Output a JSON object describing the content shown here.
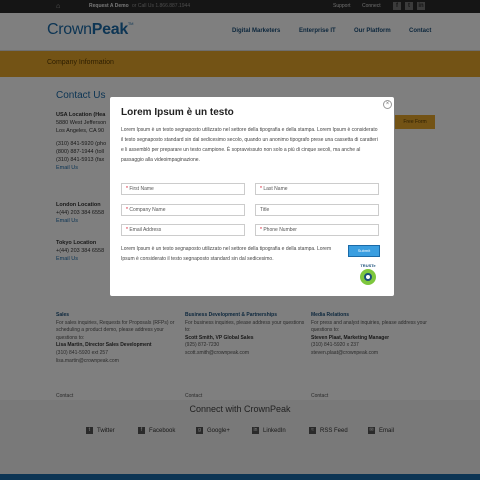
{
  "topbar": {
    "request_demo": "Request A Demo",
    "call_text": "or Call Us 1.866.887.1944",
    "support": "Support",
    "connect": "Connect"
  },
  "header": {
    "logo_main": "Crown",
    "logo_bold": "Peak",
    "logo_tm": "TM",
    "nav": [
      "Digital Marketers",
      "Enterprise IT",
      "Our Platform",
      "Contact"
    ]
  },
  "banner": {
    "title": "Company Information"
  },
  "contact": {
    "title": "Contact Us",
    "free_form_button": "Free Form",
    "usa": {
      "title": "USA Location (Hea",
      "line1": "5880 West Jefferson",
      "line2": "Los Angeles, CA 90",
      "phone1": "(310) 841-5920 (pho",
      "phone2": "(800) 887-1944 (toll",
      "phone3": "(310) 841-5913 (fax",
      "email": "Email Us"
    },
    "london": {
      "title": "London Location",
      "phone": "+(44) 203 384 6558",
      "email": "Email Us"
    },
    "tokyo": {
      "title": "Tokyo Location",
      "phone": "+(44) 203 384 6558",
      "email": "Email Us"
    }
  },
  "lower": {
    "sales": {
      "heading": "Sales",
      "desc": "For sales inquiries, Requests for Proposals (RFPs) or scheduling a product demo, please address your questions to:",
      "name": "Lisa Martin, Director Sales Development",
      "phone": "(310) 841-5920 ext 257",
      "email": "lisa.martin@crownpeak.com",
      "button": "Contact"
    },
    "bizdev": {
      "heading": "Business Development & Partnerships",
      "desc": "For business inquiries, please address your questions to:",
      "name": "Scott Smith, VP Global Sales",
      "phone": "(925) 872-7230",
      "email": "scott.smith@crownpeak.com",
      "button": "Contact"
    },
    "media": {
      "heading": "Media Relations",
      "desc": "For press and analyst inquiries, please address your questions to:",
      "name": "Steven Plaat, Marketing Manager",
      "phone": "(310) 841-5920 x 237",
      "email": "steven.plaat@crownpeak.com",
      "button": "Contact"
    }
  },
  "footer": {
    "title": "Connect with CrownPeak",
    "social": [
      "Twitter",
      "Facebook",
      "Google+",
      "LinkedIn",
      "RSS Feed",
      "Email"
    ]
  },
  "modal": {
    "title": "Lorem Ipsum è un testo",
    "desc": "Lorem Ipsum è un testo segnaposto utilizzato nel settore della tipografia e della stampa. Lorem Ipsum è considerato il testo segnaposto standard sin dal sedicesimo secolo, quando un anonimo tipografo prese una cassetta di caratteri e li assemblò per preparare un testo campione. È sopravvissuto non solo a più di cinque secoli, ma anche al passaggio alla videoimpaginazione.",
    "fields": {
      "first_name": "First Name",
      "last_name": "Last Name",
      "company": "Company Name",
      "title": "Title",
      "email": "Email Address",
      "phone": "Phone Number"
    },
    "required_mark": "*",
    "note": "Lorem Ipsum è un testo segnaposto utilizzato nel settore della tipografia e della stampa. Lorem Ipsum è considerato il testo segnaposto standard sin dal sedicesimo.",
    "submit": "Submit",
    "truste": "TRUSTe",
    "close": "×"
  },
  "icons": {
    "home": "home-icon",
    "close": "close-icon",
    "truste": "truste-seal-icon"
  },
  "colors": {
    "brand_blue": "#1a6aa8",
    "banner_orange": "#e7a62b",
    "submit_blue": "#3a9ee0",
    "required_red": "#d0021b"
  }
}
